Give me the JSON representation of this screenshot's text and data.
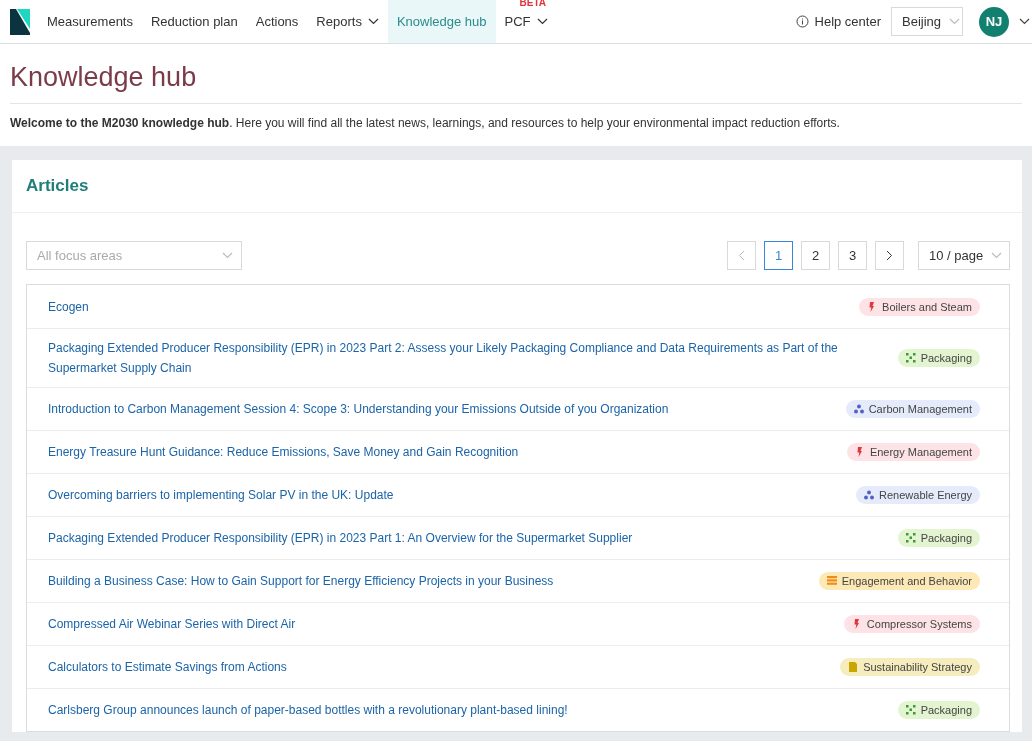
{
  "nav": {
    "items": [
      {
        "label": "Measurements",
        "selected": false,
        "dropdown": false
      },
      {
        "label": "Reduction plan",
        "selected": false,
        "dropdown": false
      },
      {
        "label": "Actions",
        "selected": false,
        "dropdown": false
      },
      {
        "label": "Reports",
        "selected": false,
        "dropdown": true
      },
      {
        "label": "Knowledge hub",
        "selected": true,
        "dropdown": false
      },
      {
        "label": "PCF",
        "selected": false,
        "dropdown": true,
        "badge": "BETA"
      }
    ],
    "help": "Help center",
    "location": "Beijing",
    "avatar": "NJ"
  },
  "page": {
    "title": "Knowledge hub",
    "intro": "**Welcome to the M2030 knowledge hub**. Here you will find all the latest news, learnings, and resources to help your environmental impact reduction efforts."
  },
  "articles": {
    "title": "Articles",
    "filter": {
      "placeholder": "All focus areas"
    },
    "pagination": {
      "pages": [
        {
          "label": "1",
          "selected": true
        },
        {
          "label": "2",
          "selected": false
        },
        {
          "label": "3",
          "selected": false
        }
      ],
      "page_size": "10 / page"
    },
    "rows": [
      {
        "title": "Ecogen",
        "tag": "Boilers and Steam",
        "kind": "energy"
      },
      {
        "title": "Packaging Extended Producer Responsibility (EPR) in 2023 Part 2: Assess your Likely Packaging Compliance and Data Requirements as Part of the Supermarket Supply Chain",
        "tag": "Packaging",
        "kind": "packaging"
      },
      {
        "title": "Introduction to Carbon Management Session 4: Scope 3: Understanding your Emissions Outside of you Organization",
        "tag": "Carbon Management",
        "kind": "carbon"
      },
      {
        "title": "Energy Treasure Hunt Guidance: Reduce Emissions, Save Money and Gain Recognition",
        "tag": "Energy Management",
        "kind": "energy"
      },
      {
        "title": "Overcoming barriers to implementing Solar PV in the UK: Update",
        "tag": "Renewable Energy",
        "kind": "carbon"
      },
      {
        "title": "Packaging Extended Producer Responsibility (EPR) in 2023 Part 1: An Overview for the Supermarket Supplier",
        "tag": "Packaging",
        "kind": "packaging"
      },
      {
        "title": "Building a Business Case: How to Gain Support for Energy Efficiency Projects in your Business",
        "tag": "Engagement and Behavior",
        "kind": "engagement"
      },
      {
        "title": "Compressed Air Webinar Series with Direct Air",
        "tag": "Compressor Systems",
        "kind": "energy"
      },
      {
        "title": "Calculators to Estimate Savings from Actions",
        "tag": "Sustainability Strategy",
        "kind": "strategy"
      },
      {
        "title": "Carlsberg Group announces launch of paper-based bottles with a revolutionary plant-based lining!",
        "tag": "Packaging",
        "kind": "packaging"
      }
    ]
  }
}
